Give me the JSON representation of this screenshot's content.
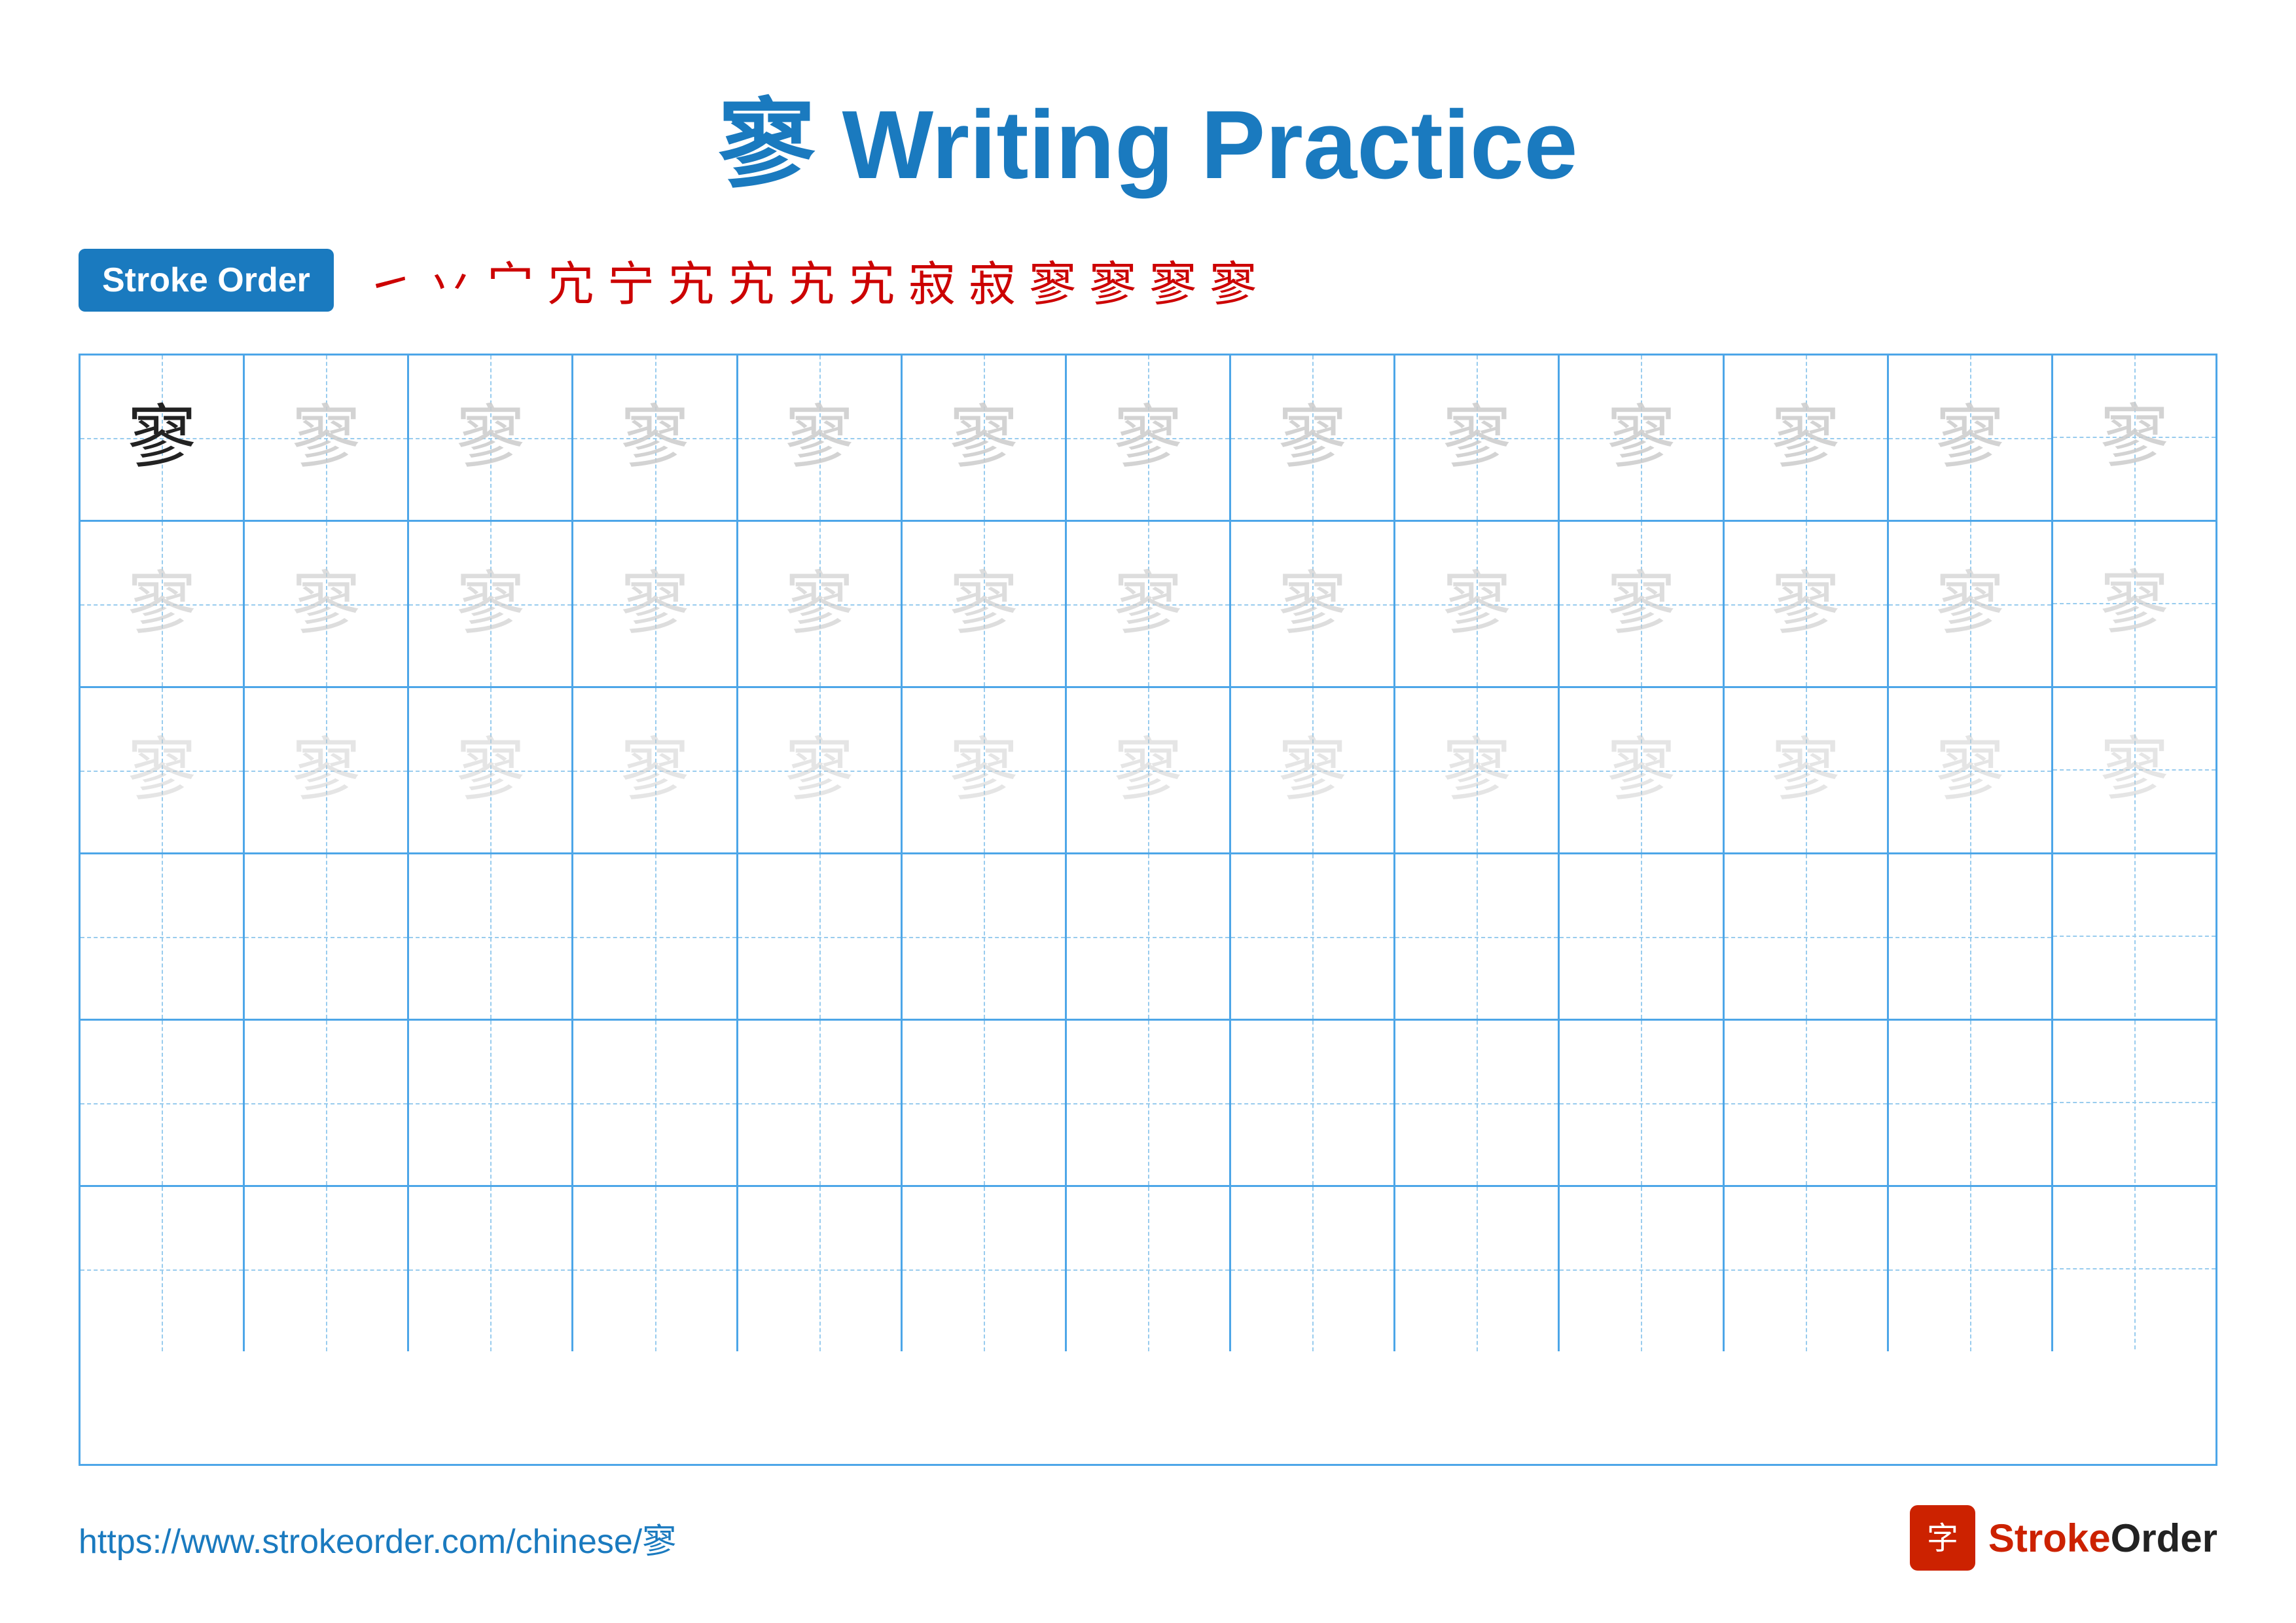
{
  "title": {
    "character": "寥",
    "label": " Writing Practice"
  },
  "stroke_order": {
    "badge_label": "Stroke Order",
    "strokes": [
      "㇀",
      "丷",
      "宀",
      "宀",
      "宁",
      "宄",
      "宄",
      "宄",
      "宄",
      "寂",
      "寂",
      "寥",
      "寥",
      "寥",
      "寥"
    ]
  },
  "grid": {
    "character": "寥",
    "rows": 6,
    "cols": 13
  },
  "footer": {
    "url": "https://www.strokeorder.com/chinese/寥",
    "logo_text": "StrokeOrder"
  }
}
